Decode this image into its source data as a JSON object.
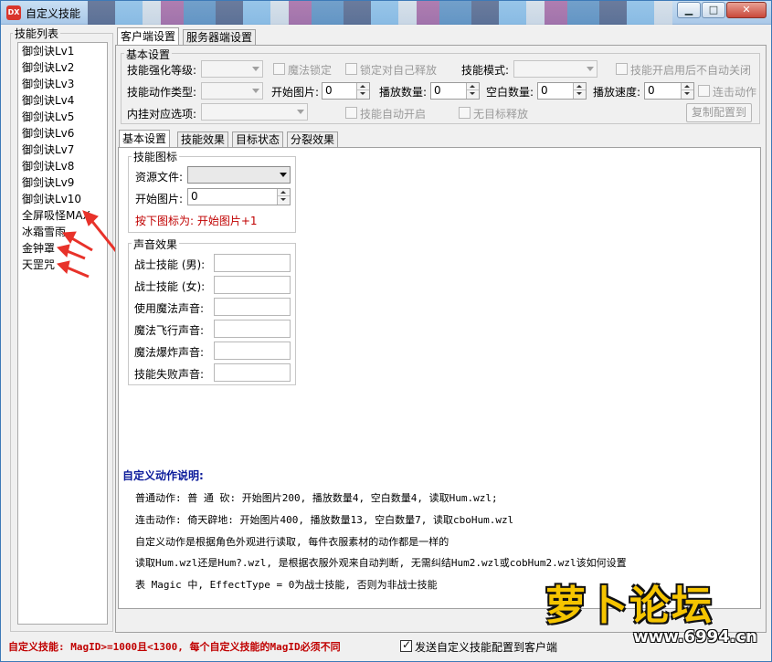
{
  "window": {
    "title": "自定义技能",
    "app_icon_text": "DX",
    "controls": {
      "minimize": "▁",
      "maximize": "□",
      "close": "✕"
    }
  },
  "skill_list": {
    "legend": "技能列表",
    "items": [
      "御剑诀Lv1",
      "御剑诀Lv2",
      "御剑诀Lv3",
      "御剑诀Lv4",
      "御剑诀Lv5",
      "御剑诀Lv6",
      "御剑诀Lv7",
      "御剑诀Lv8",
      "御剑诀Lv9",
      "御剑诀Lv10",
      "全屏吸怪MAX",
      "冰霜雪雨",
      "金钟罩",
      "天罡咒"
    ]
  },
  "tabs": {
    "client": "客户端设置",
    "server": "服务器端设置"
  },
  "basic": {
    "legend": "基本设置",
    "enhance_level_label": "技能强化等级:",
    "magic_lock_label": "魔法锁定",
    "lock_self_label": "锁定对自己释放",
    "skill_mode_label": "技能模式:",
    "no_auto_close_label": "技能开启用后不自动关闭",
    "action_type_label": "技能动作类型:",
    "start_frame_label": "开始图片:",
    "start_frame_value": "0",
    "play_count_label": "播放数量:",
    "play_count_value": "0",
    "blank_count_label": "空白数量:",
    "blank_count_value": "0",
    "play_speed_label": "播放速度:",
    "play_speed_value": "0",
    "combo_action_label": "连击动作",
    "plugin_label": "内挂对应选项:",
    "auto_start_label": "技能自动开启",
    "no_target_label": "无目标释放",
    "copy_button": "复制配置到"
  },
  "subtabs": [
    "基本设置",
    "技能效果",
    "目标状态",
    "分裂效果"
  ],
  "icon_group": {
    "legend": "技能图标",
    "resource_label": "资源文件:",
    "start_label": "开始图片:",
    "start_value": "0",
    "hint": "按下图标为: 开始图片+1"
  },
  "sound_group": {
    "legend": "声音效果",
    "labels": [
      "战士技能 (男):",
      "战士技能 (女):",
      "使用魔法声音:",
      "魔法飞行声音:",
      "魔法爆炸声音:",
      "技能失败声音:"
    ]
  },
  "notes": {
    "heading": "自定义动作说明:",
    "lines": [
      "普通动作: 普 通 砍: 开始图片200, 播放数量4, 空白数量4, 读取Hum.wzl;",
      "连击动作: 倚天辟地: 开始图片400, 播放数量13, 空白数量7, 读取cboHum.wzl",
      "自定义动作是根据角色外观进行读取, 每件衣服素材的动作都是一样的",
      "读取Hum.wzl还是Hum?.wzl, 是根据衣服外观来自动判断, 无需纠结Hum2.wzl或cobHum2.wzl该如何设置",
      "表 Magic 中, EffectType = 0为战士技能, 否则为非战士技能"
    ]
  },
  "footer": {
    "warning": "自定义技能: MagID>=1000且<1300, 每个自定义技能的MagID必须不同",
    "send_config_label": "发送自定义技能配置到客户端"
  },
  "watermark": {
    "title": "萝卜论坛",
    "url": "www.6994.cn"
  },
  "colors": {
    "warning_red": "#c00000",
    "heading_blue": "#0a1a9a",
    "arrow_red": "#e8322a"
  }
}
